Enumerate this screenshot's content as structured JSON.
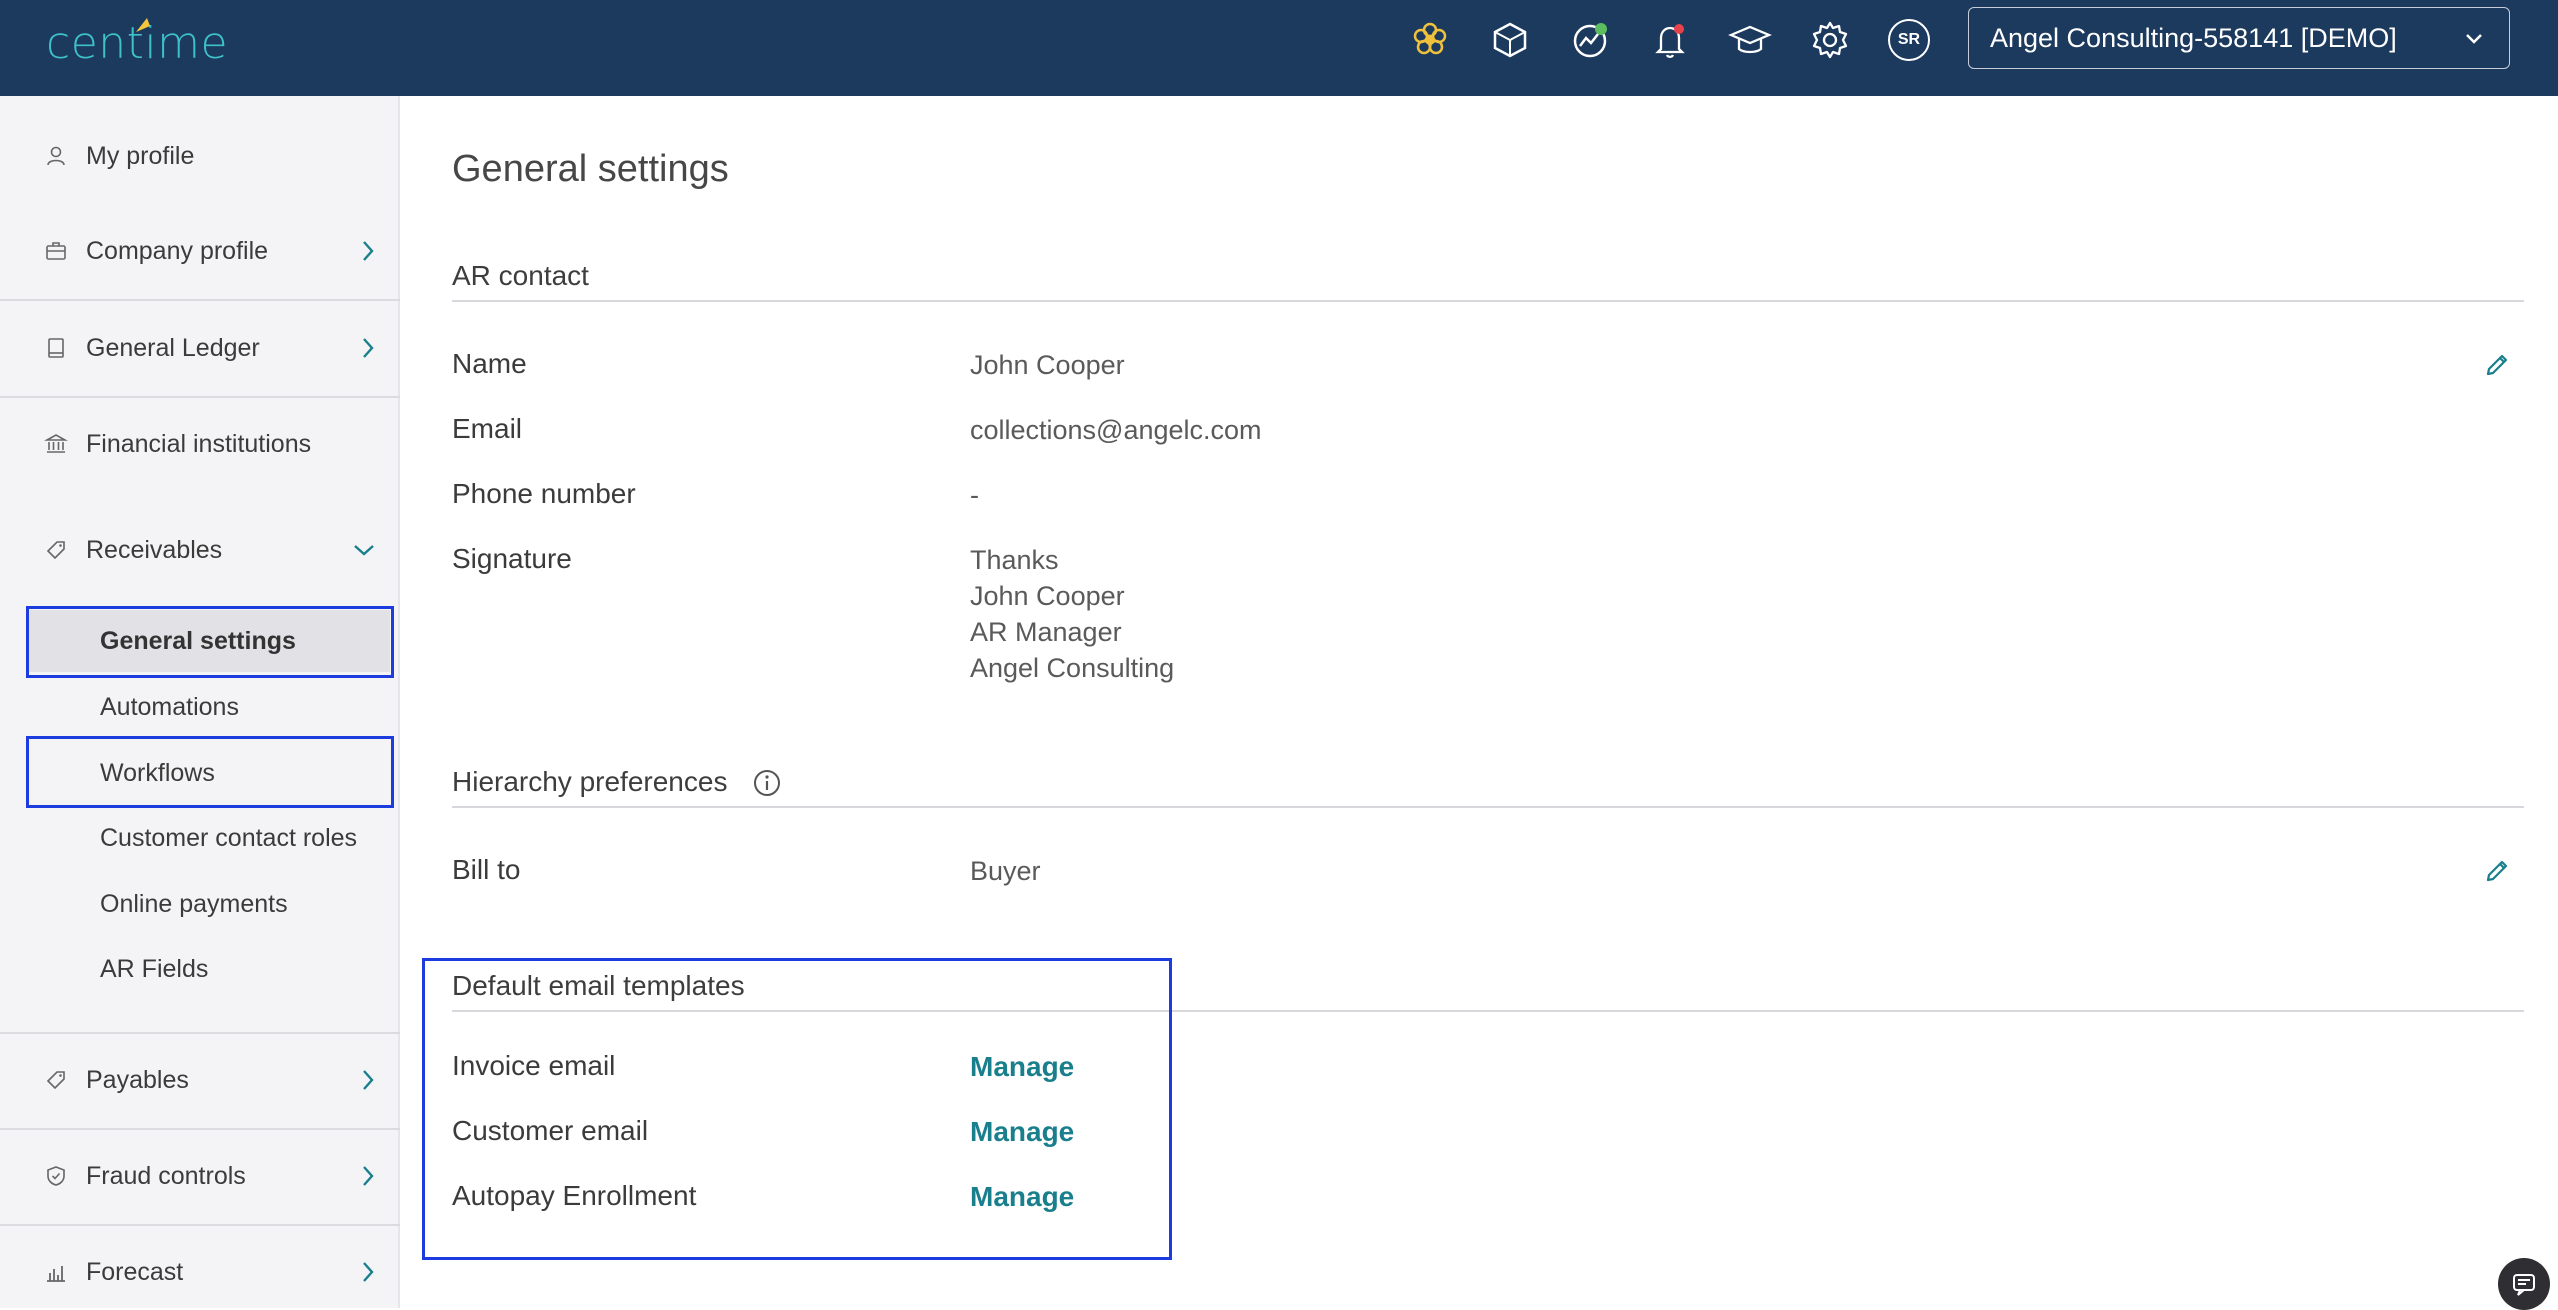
{
  "topbar": {
    "logo_text": "centime",
    "icons": [
      "flower-icon",
      "box-icon",
      "chart-growth-icon",
      "bell-icon",
      "graduation-cap-icon",
      "gear-icon"
    ],
    "avatar_initials": "SR",
    "company_selector": "Angel Consulting-558141 [DEMO]",
    "notification_dot_color": "#e8434a"
  },
  "sidebar": {
    "items": [
      {
        "label": "My profile",
        "icon": "user-icon"
      },
      {
        "label": "Company profile",
        "icon": "briefcase-icon"
      },
      {
        "label": "General Ledger",
        "icon": "book-icon"
      },
      {
        "label": "Financial institutions",
        "icon": "bank-icon"
      },
      {
        "label": "Receivables",
        "icon": "tag-icon"
      },
      {
        "label": "Payables",
        "icon": "tag-icon"
      },
      {
        "label": "Fraud controls",
        "icon": "shield-icon"
      },
      {
        "label": "Forecast",
        "icon": "bar-chart-icon"
      }
    ],
    "receivables_subitems": [
      {
        "label": "General settings",
        "active": true
      },
      {
        "label": "Automations"
      },
      {
        "label": "Workflows"
      },
      {
        "label": "Customer contact roles"
      },
      {
        "label": "Online payments"
      },
      {
        "label": "AR Fields"
      }
    ]
  },
  "main": {
    "title": "General settings",
    "ar_contact": {
      "heading": "AR contact",
      "name_label": "Name",
      "name_value": "John Cooper",
      "email_label": "Email",
      "email_value": "collections@angelc.com",
      "phone_label": "Phone number",
      "phone_value": "-",
      "signature_label": "Signature",
      "signature_lines": [
        "Thanks",
        "John Cooper",
        "AR Manager",
        "Angel Consulting"
      ]
    },
    "hierarchy": {
      "heading": "Hierarchy preferences",
      "bill_to_label": "Bill to",
      "bill_to_value": "Buyer"
    },
    "email_templates": {
      "heading": "Default email templates",
      "rows": [
        {
          "label": "Invoice email",
          "action": "Manage"
        },
        {
          "label": "Customer email",
          "action": "Manage"
        },
        {
          "label": "Autopay Enrollment",
          "action": "Manage"
        }
      ]
    }
  },
  "colors": {
    "topbar": "#1c3a5e",
    "accent": "#1a7f8c",
    "highlight_box": "#1c3ce0"
  }
}
